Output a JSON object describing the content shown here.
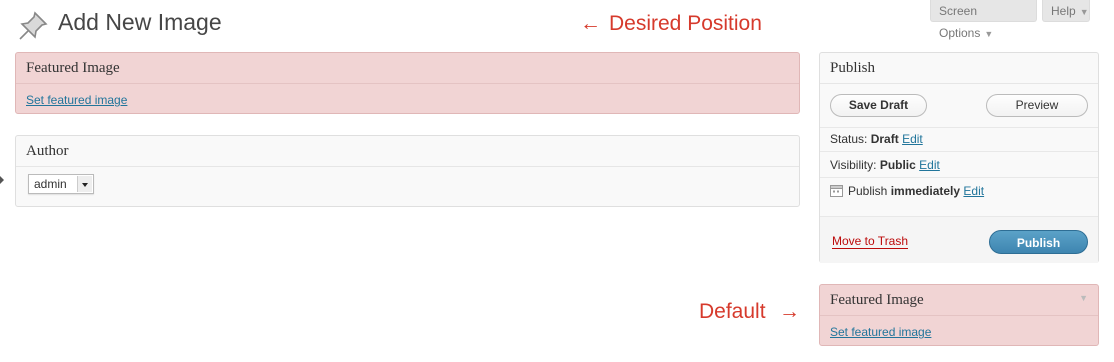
{
  "header": {
    "title": "Add New Image"
  },
  "tabs": {
    "screen_options": "Screen Options",
    "help": "Help"
  },
  "annotations": {
    "desired": "Desired Position",
    "default": "Default"
  },
  "featured_top": {
    "title": "Featured Image",
    "link": "Set featured image"
  },
  "author": {
    "title": "Author",
    "selected": "admin"
  },
  "publish": {
    "title": "Publish",
    "save_draft": "Save Draft",
    "preview": "Preview",
    "status_label": "Status:",
    "status_value": "Draft",
    "visibility_label": "Visibility:",
    "visibility_value": "Public",
    "publish_label": "Publish",
    "publish_value": "immediately",
    "edit": "Edit",
    "trash": "Move to Trash",
    "publish_button": "Publish"
  },
  "featured_bottom": {
    "title": "Featured Image",
    "link": "Set featured image"
  },
  "colors": {
    "annotation": "#d63a2c",
    "highlight": "#f1d4d4",
    "link": "#21759b",
    "primary": "#3e85b0"
  }
}
